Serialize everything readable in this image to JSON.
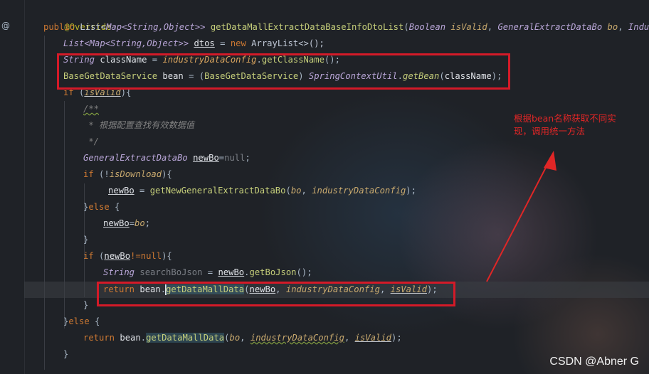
{
  "editor": {
    "gutter_mark": "@",
    "lines": {
      "l1_ann": "@Override",
      "l2_public": "public ",
      "l2_list": "List",
      "l2_lt": "<",
      "l2_map": "Map",
      "l2_gen": "<String,Object>> ",
      "l2_method": "getDataMallExtractDataBaseInfoDtoList",
      "l2_open": "(",
      "l2_boolean": "Boolean ",
      "l2_isvalid": "isValid",
      "l2_comma": ", ",
      "l2_gedb": "GeneralExtractDataBo ",
      "l2_bo": "bo",
      "l2_comma2": ", ",
      "l2_tail": "IndustryDa",
      "l3_type": "List<Map<String,Object>> ",
      "l3_var": "dtos",
      "l3_eq": " = ",
      "l3_new": "new ",
      "l3_rhs": "ArrayList<>();",
      "l4_type": "String ",
      "l4_var": "className",
      "l4_eq": " = ",
      "l4_field": "industryDataConfig",
      "l4_dot": ".",
      "l4_call": "getClassName",
      "l4_end": "();",
      "l5_type": "BaseGetDataService ",
      "l5_var": "bean",
      "l5_eq": " = (",
      "l5_cast": "BaseGetDataService",
      "l5_close": ") ",
      "l5_util": "SpringContextUtil",
      "l5_dot": ".",
      "l5_call": "getBean",
      "l5_open": "(",
      "l5_arg": "className",
      "l5_end": ");",
      "l6_if": "if ",
      "l6_open": "(",
      "l6_cond": "isValid",
      "l6_end": "){",
      "l7_cmt": "/**",
      "l8_cmt": " * 根据配置查找有效数据值",
      "l9_cmt": " */",
      "l10_type": "GeneralExtractDataBo ",
      "l10_var": "newBo",
      "l10_eq": "=",
      "l10_null": "null",
      "l10_end": ";",
      "l11_if": "if ",
      "l11_open": "(!",
      "l11_cond": "isDownload",
      "l11_end": "){",
      "l12_var": "newBo",
      "l12_eq": " = ",
      "l12_call": "getNewGeneralExtractDataBo",
      "l12_open": "(",
      "l12_a1": "bo",
      "l12_sep": ", ",
      "l12_a2": "industryDataConfig",
      "l12_end": ");",
      "l13_close": "}",
      "l13_else": "else ",
      "l13_open": "{",
      "l14_var": "newBo",
      "l14_eq": "=",
      "l14_val": "bo",
      "l14_end": ";",
      "l15_close": "}",
      "l16_if": "if ",
      "l16_open": "(",
      "l16_var": "newBo",
      "l16_cmp": "!=",
      "l16_null": "null",
      "l16_end": "){",
      "l17_type": "String ",
      "l17_var": "searchBoJson",
      "l17_eq": " = ",
      "l17_obj": "newBo",
      "l17_dot": ".",
      "l17_call": "getBoJson",
      "l17_end": "();",
      "l18_ret": "return ",
      "l18_obj": "bean",
      "l18_dot": ".",
      "l18_call": "getDataMallData",
      "l18_open": "(",
      "l18_a1": "newBo",
      "l18_sep": ", ",
      "l18_a2": "industryDataConfig",
      "l18_sep2": ", ",
      "l18_a3": "isValid",
      "l18_end": ");",
      "l19_close": "}",
      "l20_close": "}",
      "l20_else": "else ",
      "l20_open": "{",
      "l21_ret": "return ",
      "l21_obj": "bean",
      "l21_dot": ".",
      "l21_call": "getDataMallData",
      "l21_open": "(",
      "l21_a1": "bo",
      "l21_sep": ", ",
      "l21_a2": "industryDataConfig",
      "l21_sep2": ", ",
      "l21_a3": "isValid",
      "l21_end": ");",
      "l22_close": "}"
    }
  },
  "annotation": {
    "note": "根据bean名称获取不同实现，调用统一方法",
    "color": "#e02626"
  },
  "watermark": "CSDN @Abner G"
}
